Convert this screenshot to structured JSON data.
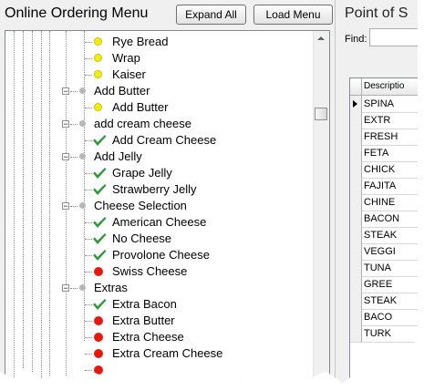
{
  "left_panel": {
    "title": "Online Ordering Menu",
    "expand_all_label": "Expand All",
    "load_menu_label": "Load Menu"
  },
  "tree": [
    {
      "label": "Rye Bread",
      "level": 2,
      "marker": "yellow-dot-icon"
    },
    {
      "label": "Wrap",
      "level": 2,
      "marker": "yellow-dot-icon"
    },
    {
      "label": "Kaiser",
      "level": 2,
      "marker": "yellow-dot-icon"
    },
    {
      "label": "Add Butter",
      "level": 1,
      "marker": "gray-dot-icon",
      "expander": "−"
    },
    {
      "label": "Add Butter",
      "level": 2,
      "marker": "yellow-dot-icon"
    },
    {
      "label": "add cream cheese",
      "level": 1,
      "marker": "gray-dot-icon",
      "expander": "−"
    },
    {
      "label": "Add Cream Cheese",
      "level": 2,
      "marker": "check-icon"
    },
    {
      "label": "Add Jelly",
      "level": 1,
      "marker": "gray-dot-icon",
      "expander": "−"
    },
    {
      "label": "Grape Jelly",
      "level": 2,
      "marker": "check-icon"
    },
    {
      "label": "Strawberry Jelly",
      "level": 2,
      "marker": "check-icon"
    },
    {
      "label": "Cheese Selection",
      "level": 1,
      "marker": "gray-dot-icon",
      "expander": "−"
    },
    {
      "label": "American Cheese",
      "level": 2,
      "marker": "check-icon"
    },
    {
      "label": "No Cheese",
      "level": 2,
      "marker": "check-icon"
    },
    {
      "label": "Provolone Cheese",
      "level": 2,
      "marker": "check-icon"
    },
    {
      "label": "Swiss Cheese",
      "level": 2,
      "marker": "red-dot-icon"
    },
    {
      "label": "Extras",
      "level": 1,
      "marker": "gray-dot-icon",
      "expander": "−"
    },
    {
      "label": "Extra Bacon",
      "level": 2,
      "marker": "check-icon"
    },
    {
      "label": "Extra Butter",
      "level": 2,
      "marker": "red-dot-icon"
    },
    {
      "label": "Extra Cheese",
      "level": 2,
      "marker": "red-dot-icon"
    },
    {
      "label": "Extra Cream Cheese",
      "level": 2,
      "marker": "red-dot-icon"
    },
    {
      "label": "",
      "level": 2,
      "marker": "red-dot-icon"
    }
  ],
  "right_panel": {
    "title": "Point of S",
    "find_label": "Find:",
    "grid_header": "Descriptio",
    "grid_rows": [
      "SPINA",
      "EXTR",
      "FRESH",
      "FETA",
      "CHICK",
      "FAJITA",
      "CHINE",
      "BACON",
      "STEAK",
      "VEGGI",
      "TUNA",
      "GREE",
      "STEAK",
      "BACO",
      "TURK"
    ]
  },
  "colors": {
    "check": "#2e9a3a",
    "yellow_dot": "#f2ee0b",
    "red_dot": "#e8190a",
    "gray_dot": "#b8b8b8"
  }
}
